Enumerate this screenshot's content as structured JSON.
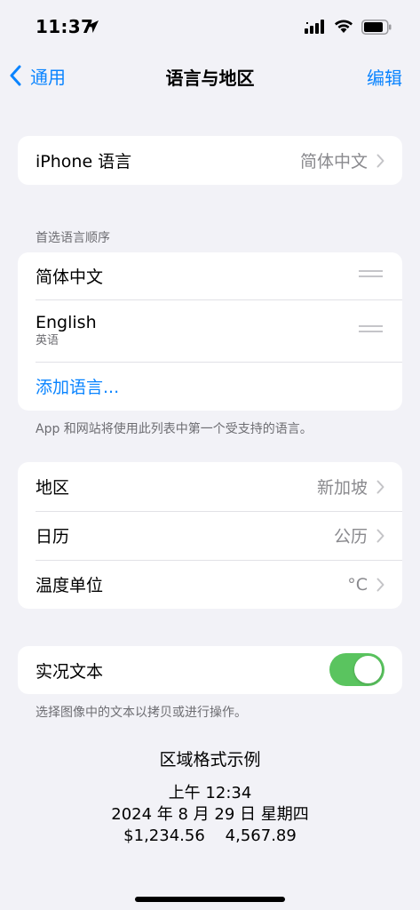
{
  "status": {
    "time": "11:37"
  },
  "nav": {
    "back_label": "通用",
    "title": "语言与地区",
    "edit_label": "编辑"
  },
  "iphone_language": {
    "label": "iPhone 语言",
    "value": "简体中文"
  },
  "preferred": {
    "header": "首选语言顺序",
    "languages": [
      {
        "name": "简体中文",
        "subtitle": ""
      },
      {
        "name": "English",
        "subtitle": "英语"
      }
    ],
    "add_label": "添加语言...",
    "footnote": "App 和网站将使用此列表中第一个受支持的语言。"
  },
  "region_group": {
    "rows": [
      {
        "label": "地区",
        "value": "新加坡"
      },
      {
        "label": "日历",
        "value": "公历"
      },
      {
        "label": "温度单位",
        "value": "°C"
      }
    ]
  },
  "live_text": {
    "label": "实况文本",
    "enabled": true,
    "footnote": "选择图像中的文本以拷贝或进行操作。"
  },
  "format_example": {
    "title": "区域格式示例",
    "time": "上午 12:34",
    "date": "2024 年 8 月 29 日 星期四",
    "numbers": "$1,234.56    4,567.89"
  },
  "colors": {
    "accent": "#0A84FF",
    "toggle_on": "#5AC45F",
    "background": "#F2F2F7"
  }
}
